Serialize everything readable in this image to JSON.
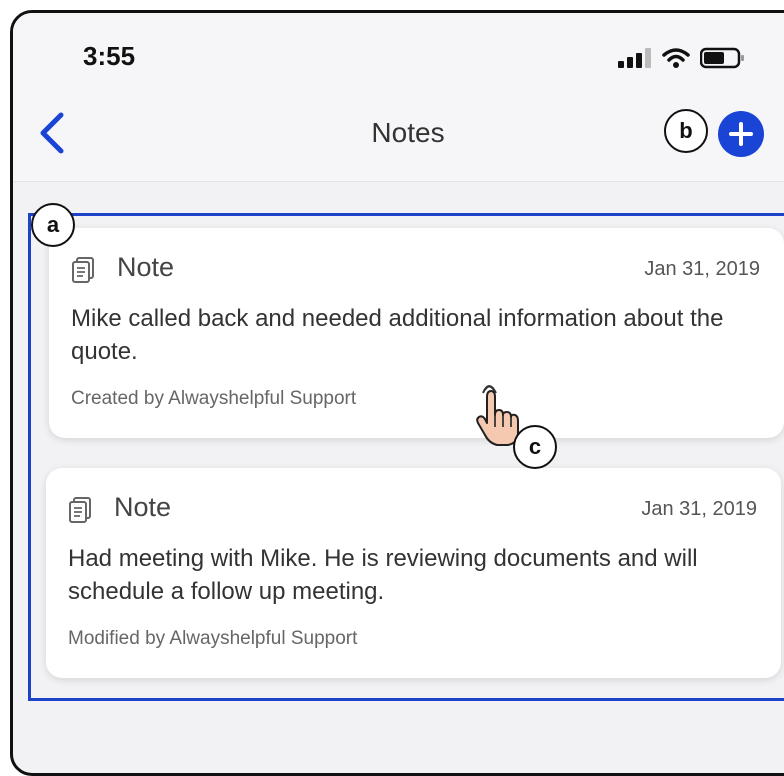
{
  "status_bar": {
    "time": "3:55"
  },
  "header": {
    "title": "Notes",
    "back_icon": "chevron-left-icon",
    "add_icon": "plus-icon"
  },
  "colors": {
    "accent": "#1a44d6",
    "frame": "#1c42c8"
  },
  "callouts": {
    "a": "a",
    "b": "b",
    "c": "c"
  },
  "notes": [
    {
      "type": "Note",
      "date": "Jan 31, 2019",
      "body": "Mike called back and needed additional information about the quote.",
      "meta": "Created by Alwayshelpful Support"
    },
    {
      "type": "Note",
      "date": "Jan 31, 2019",
      "body": "Had meeting with Mike. He is reviewing documents and will schedule a follow up meeting.",
      "meta": "Modified by Alwayshelpful Support"
    }
  ]
}
